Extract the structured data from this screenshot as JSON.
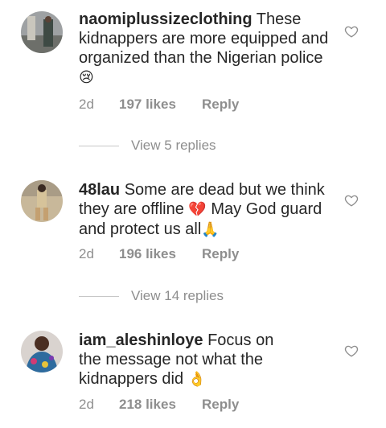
{
  "comments": [
    {
      "username": "naomiplussizeclothing",
      "text": "These kidnappers are more equipped and organized than the Nigerian police",
      "emoji": "😢",
      "time": "2d",
      "likes": "197 likes",
      "reply": "Reply",
      "replies_label": "View 5 replies"
    },
    {
      "username": "48lau",
      "text_a": "Some are dead but we think they are offline",
      "emoji_a": "💔",
      "text_b": "May God guard and  protect us all",
      "emoji_b": "🙏",
      "time": "2d",
      "likes": "196 likes",
      "reply": "Reply",
      "replies_label": "View 14 replies"
    },
    {
      "username": "iam_aleshinloye",
      "text": "Focus on the message not what the kidnappers did",
      "emoji": "👌",
      "time": "2d",
      "likes": "218 likes",
      "reply": "Reply"
    }
  ],
  "icons": {
    "like": "heart-outline-icon"
  },
  "colors": {
    "text": "#262626",
    "meta": "#8e8e8e",
    "divider": "#c7c7c7"
  }
}
